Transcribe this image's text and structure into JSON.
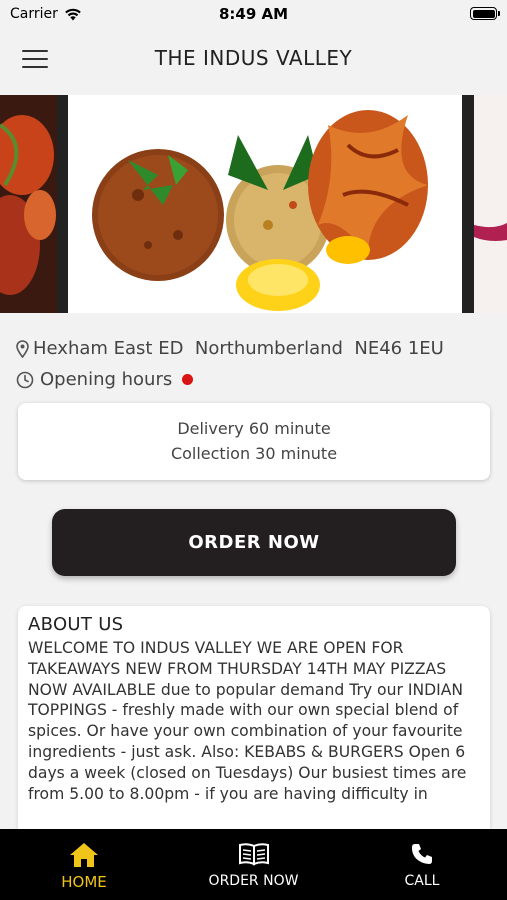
{
  "status_bar": {
    "carrier": "Carrier",
    "time": "8:49 AM"
  },
  "header": {
    "title": "THE INDUS VALLEY",
    "menu_icon": "hamburger-menu-icon"
  },
  "restaurant": {
    "address": "Hexham East ED  Northumberland  NE46 1EU",
    "hours_label": "Opening hours",
    "open_status_color": "#d81414"
  },
  "times": {
    "delivery": "Delivery 60 minute",
    "collection": "Collection 30 minute"
  },
  "order_button": "ORDER NOW",
  "about": {
    "title": "ABOUT US",
    "body": "WELCOME TO INDUS VALLEY  WE ARE OPEN FOR TAKEAWAYS  NEW FROM THURSDAY 14TH MAY PIZZAS NOW AVAILABLE due to popular demand Try our INDIAN TOPPINGS - freshly made with our own special blend of spices. Or have your own combination of your favourite ingredients - just ask. Also: KEBABS & BURGERS Open 6 days a week (closed on Tuesdays) Our busiest times are from 5.00 to 8.00pm - if you are having difficulty in"
  },
  "tabs": [
    {
      "label": "HOME",
      "icon": "home-icon",
      "active": true
    },
    {
      "label": "ORDER NOW",
      "icon": "menu-book-icon",
      "active": false
    },
    {
      "label": "CALL",
      "icon": "phone-icon",
      "active": false
    }
  ],
  "colors": {
    "accent": "#f0c419",
    "button": "#231f20",
    "tab_bar": "#000000"
  }
}
